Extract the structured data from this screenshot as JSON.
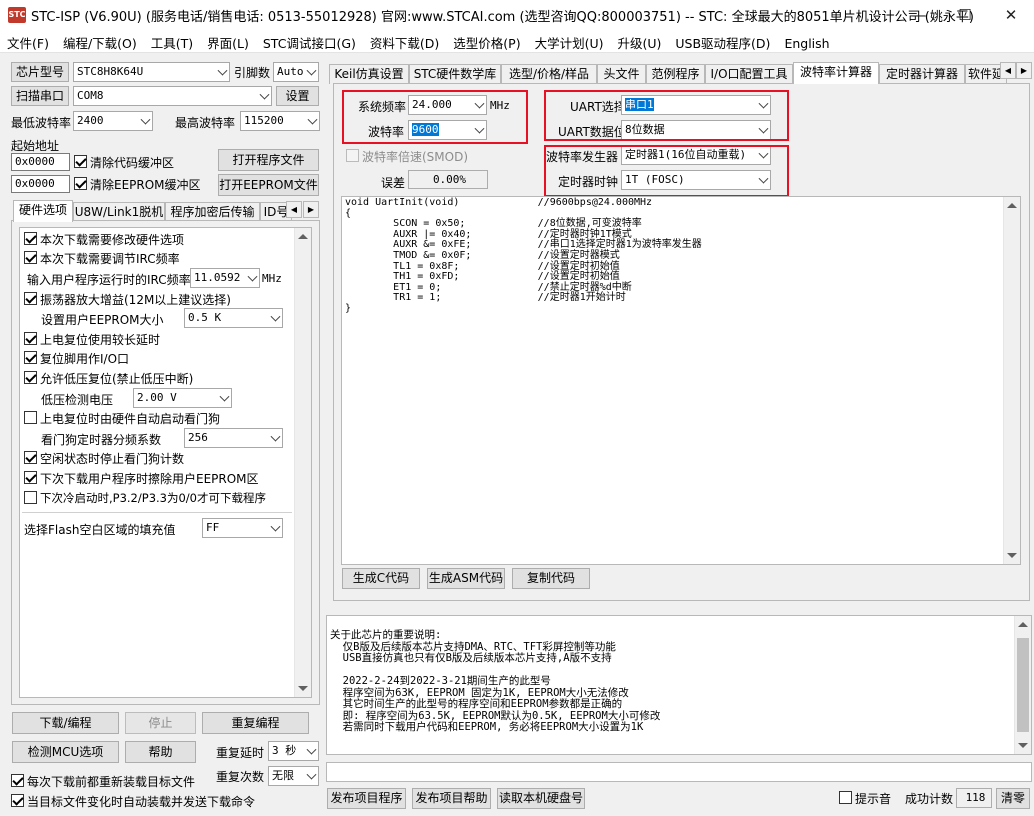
{
  "window": {
    "title": "STC-ISP (V6.90U) (服务电话/销售电话: 0513-55012928) 官网:www.STCAI.com  (选型咨询QQ:800003751) -- STC: 全球最大的8051单片机设计公司 (姚永平)",
    "minimize": "—",
    "maximize": "☐",
    "close": "✕"
  },
  "menu": [
    "文件(F)",
    "编程/下载(O)",
    "工具(T)",
    "界面(L)",
    "STC调试接口(G)",
    "资料下载(D)",
    "选型价格(P)",
    "大学计划(U)",
    "升级(U)",
    "USB驱动程序(D)",
    "English"
  ],
  "left": {
    "chip_model_btn": "芯片型号",
    "chip_model": "STC8H8K64U",
    "pin_count_label": "引脚数",
    "pin_count": "Auto",
    "scan_port_btn": "扫描串口",
    "port": "COM8",
    "settings_btn": "设置",
    "min_baud_label": "最低波特率",
    "min_baud": "2400",
    "max_baud_label": "最高波特率",
    "max_baud": "115200",
    "start_addr_label": "起始地址",
    "addr1": "0x0000",
    "clear_code_label": "清除代码缓冲区",
    "open_program_btn": "打开程序文件",
    "addr2": "0x0000",
    "clear_eeprom_label": "清除EEPROM缓冲区",
    "open_eeprom_btn": "打开EEPROM文件",
    "tabs": [
      "硬件选项",
      "U8W/Link1脱机",
      "程序加密后传输",
      "ID号"
    ],
    "options": [
      {
        "label": "本次下载需要修改硬件选项",
        "checked": true
      },
      {
        "label": "本次下载需要调节IRC频率",
        "checked": true
      },
      {
        "label": "振荡器放大增益(12M以上建议选择)",
        "checked": true
      },
      {
        "label": "上电复位使用较长延时",
        "checked": true
      },
      {
        "label": "复位脚用作I/O口",
        "checked": true
      },
      {
        "label": "允许低压复位(禁止低压中断)",
        "checked": true
      },
      {
        "label": "上电复位时由硬件自动启动看门狗",
        "checked": false
      },
      {
        "label": "空闲状态时停止看门狗计数",
        "checked": true
      },
      {
        "label": "下次下载用户程序时擦除用户EEPROM区",
        "checked": true
      },
      {
        "label": "下次冷启动时,P3.2/P3.3为0/0才可下载程序",
        "checked": false
      }
    ],
    "irc_label": "输入用户程序运行时的IRC频率",
    "irc_value": "11.0592",
    "irc_unit": "MHz",
    "eeprom_size_label": "设置用户EEPROM大小",
    "eeprom_size": "0.5 K",
    "lvd_label": "低压检测电压",
    "lvd_value": "2.00 V",
    "wdt_div_label": "看门狗定时器分频系数",
    "wdt_div": "256",
    "fill_label": "选择Flash空白区域的填充值",
    "fill_value": "FF",
    "download_btn": "下载/编程",
    "stop_btn": "停止",
    "reprogram_btn": "重复编程",
    "check_mcu_btn": "检测MCU选项",
    "help_btn": "帮助",
    "repeat_delay_label": "重复延时",
    "repeat_delay": "3 秒",
    "repeat_count_label": "重复次数",
    "repeat_count": "无限",
    "reload_label": "每次下载前都重新装载目标文件",
    "auto_load_label": "当目标文件变化时自动装载并发送下载命令"
  },
  "right": {
    "tabs": [
      "Keil仿真设置",
      "STC硬件数学库",
      "选型/价格/样品",
      "头文件",
      "范例程序",
      "I/O口配置工具",
      "波特率计算器",
      "定时器计算器",
      "软件延"
    ],
    "sys_freq_label": "系统频率",
    "sys_freq": "24.000",
    "sys_freq_unit": "MHz",
    "baud_label": "波特率",
    "baud": "9600",
    "baud_double_label": "波特率倍速(SMOD)",
    "error_label": "误差",
    "error_value": "0.00%",
    "uart_sel_label": "UART选择",
    "uart_sel": "串口1",
    "uart_bits_label": "UART数据位",
    "uart_bits": "8位数据",
    "baud_gen_label": "波特率发生器",
    "baud_gen": "定时器1(16位自动重载)",
    "timer_clk_label": "定时器时钟",
    "timer_clk": "1T  (FOSC)",
    "code": "void UartInit(void)\t\t//9600bps@24.000MHz\n{\n\tSCON = 0x50;\t\t//8位数据,可变波特率\n\tAUXR |= 0x40;\t\t//定时器时钟1T模式\n\tAUXR &= 0xFE;\t\t//串口1选择定时器1为波特率发生器\n\tTMOD &= 0x0F;\t\t//设置定时器模式\n\tTL1 = 0x8F;\t\t//设置定时初始值\n\tTH1 = 0xFD;\t\t//设置定时初始值\n\tET1 = 0;\t\t//禁止定时器%d中断\n\tTR1 = 1;\t\t//定时器1开始计时\n}",
    "gen_c_btn": "生成C代码",
    "gen_asm_btn": "生成ASM代码",
    "copy_btn": "复制代码",
    "info": "关于此芯片的重要说明:\n  仅B版及后续版本芯片支持DMA、RTC、TFT彩屏控制等功能\n  USB直接仿真也只有仅B版及后续版本芯片支持,A版不支持\n\n  2022-2-24到2022-3-21期间生产的此型号\n  程序空间为63K, EEPROM 固定为1K, EEPROM大小无法修改\n  其它时间生产的此型号的程序空间和EEPROM参数都是正确的\n  即: 程序空间为63.5K, EEPROM默认为0.5K, EEPROM大小可修改\n  若需同时下载用户代码和EEPROM, 务必将EEPROM大小设置为1K",
    "publish_btn": "发布项目程序",
    "publish_help_btn": "发布项目帮助",
    "read_disk_btn": "读取本机硬盘号",
    "beep_label": "提示音",
    "success_label": "成功计数",
    "success_count": "118",
    "clear_btn": "清零"
  }
}
